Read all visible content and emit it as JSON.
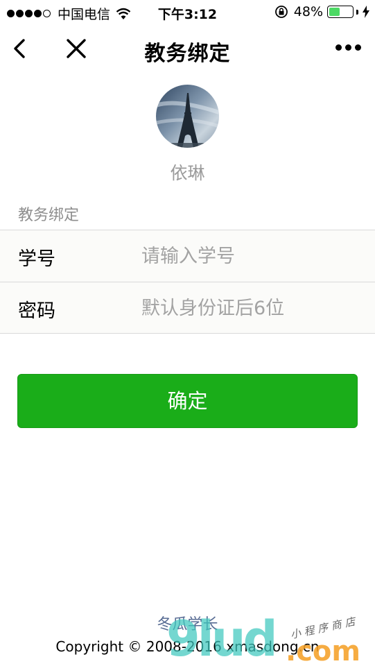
{
  "status_bar": {
    "carrier": "中国电信",
    "time": "下午3:12",
    "battery_percent": "48%",
    "battery_level": 0.48,
    "icons": [
      "signal-dots-icon",
      "wifi-icon",
      "orientation-lock-icon",
      "battery-icon",
      "charging-bolt-icon"
    ]
  },
  "nav": {
    "title": "教务绑定",
    "back_icon": "chevron-left-icon",
    "close_icon": "close-icon",
    "more_icon": "more-dots-icon"
  },
  "profile": {
    "name": "依琳",
    "avatar_icon": "eiffel-tower-avatar"
  },
  "section_title": "教务绑定",
  "form": {
    "student_id": {
      "label": "学号",
      "placeholder": "请输入学号",
      "value": ""
    },
    "password": {
      "label": "密码",
      "placeholder": "默认身份证后6位",
      "value": ""
    }
  },
  "confirm_label": "确定",
  "footer": {
    "link": "冬瓜学长",
    "copyright": "Copyright © 2008-2016 xmasdong.cn"
  },
  "watermark": {
    "brand": "9lud",
    "domain": ".com",
    "tagline": "小程序商店"
  },
  "colors": {
    "primary_button": "#1aad19",
    "battery": "#4cd964",
    "link": "#586c94",
    "placeholder": "#a3a3a3"
  }
}
